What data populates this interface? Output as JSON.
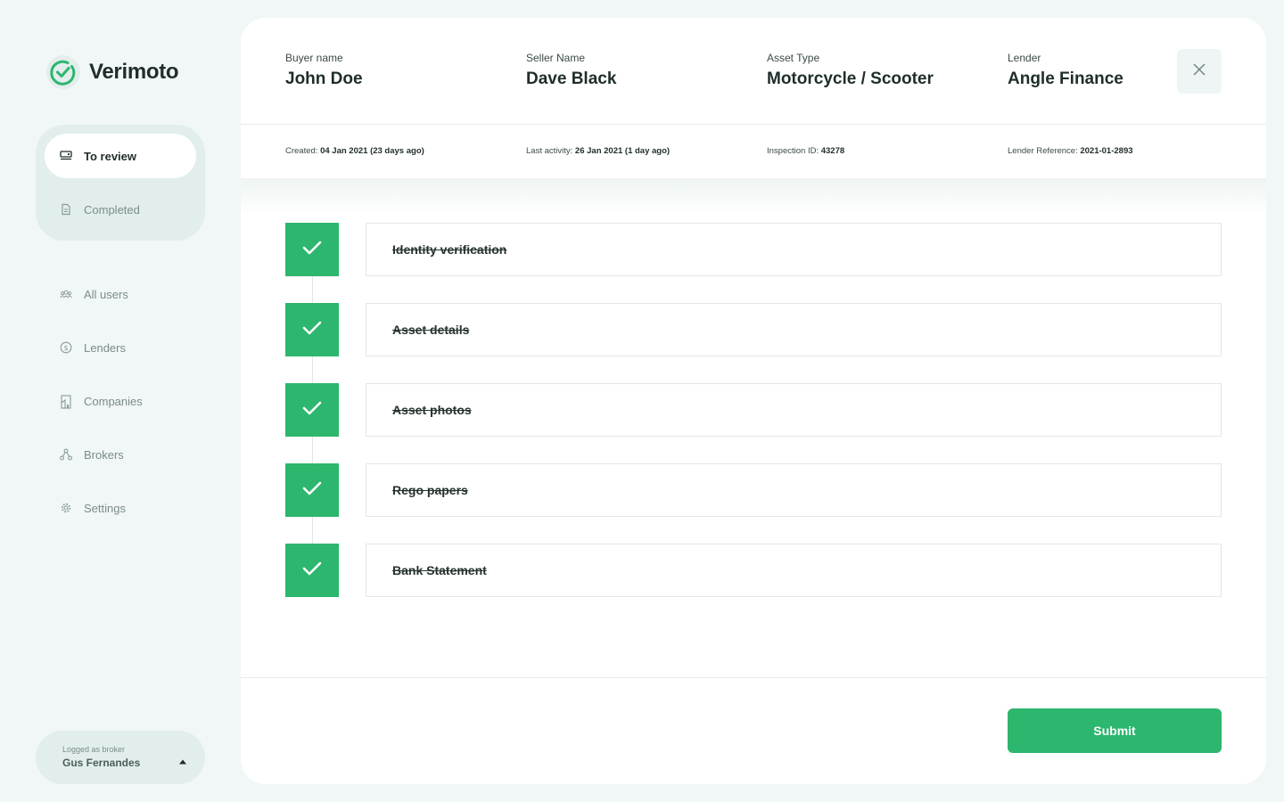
{
  "brand": {
    "name": "Verimoto",
    "accent": "#2db66e"
  },
  "sidebar": {
    "review_items": [
      {
        "label": "To review",
        "icon": "inbox-icon",
        "active": true
      },
      {
        "label": "Completed",
        "icon": "document-icon",
        "active": false
      }
    ],
    "menu_items": [
      {
        "label": "All users",
        "icon": "users-icon"
      },
      {
        "label": "Lenders",
        "icon": "dollar-icon"
      },
      {
        "label": "Companies",
        "icon": "building-icon"
      },
      {
        "label": "Brokers",
        "icon": "network-icon"
      },
      {
        "label": "Settings",
        "icon": "gear-icon"
      }
    ],
    "user": {
      "role": "Logged as broker",
      "name": "Gus Fernandes"
    }
  },
  "header": {
    "fields": [
      {
        "label": "Buyer name",
        "value": "John Doe"
      },
      {
        "label": "Seller Name",
        "value": "Dave Black"
      },
      {
        "label": "Asset Type",
        "value": "Motorcycle / Scooter"
      },
      {
        "label": "Lender",
        "value": "Angle Finance"
      }
    ],
    "meta": [
      {
        "label": "Created:",
        "value": "04 Jan 2021 (23 days ago)"
      },
      {
        "label": "Last activity:",
        "value": "26 Jan 2021 (1 day ago)"
      },
      {
        "label": "Inspection ID:",
        "value": "43278"
      },
      {
        "label": "Lender Reference:",
        "value": "2021-01-2893"
      }
    ]
  },
  "steps": [
    {
      "label": "Identity verification",
      "done": true
    },
    {
      "label": "Asset details",
      "done": true
    },
    {
      "label": "Asset photos",
      "done": true
    },
    {
      "label": "Rego papers",
      "done": true
    },
    {
      "label": "Bank Statement",
      "done": true
    }
  ],
  "actions": {
    "submit_label": "Submit"
  }
}
